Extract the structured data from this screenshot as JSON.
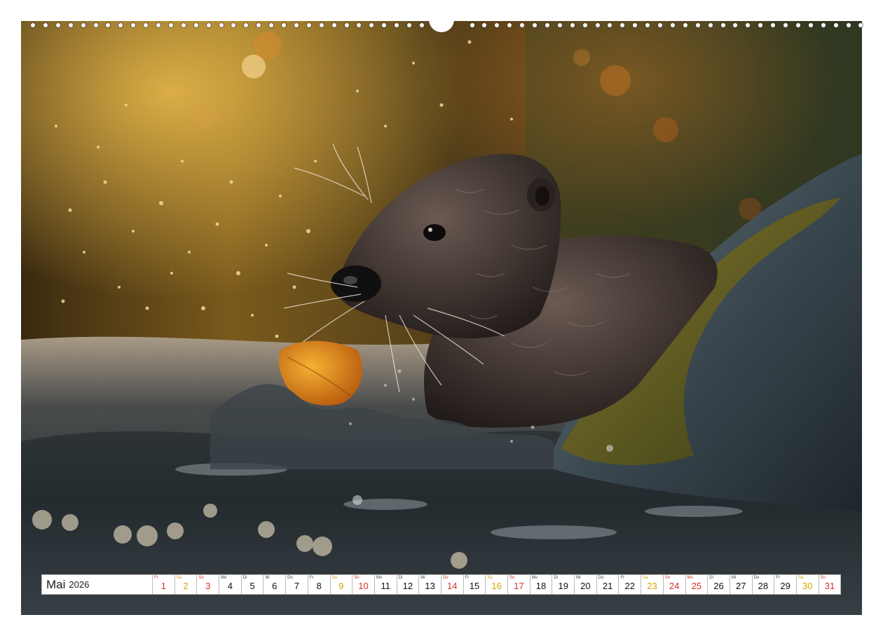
{
  "calendar": {
    "month": "Mai",
    "year": "2026",
    "days": [
      {
        "wd": "Fr",
        "num": "1",
        "type": "hol"
      },
      {
        "wd": "Sa",
        "num": "2",
        "type": "sat"
      },
      {
        "wd": "So",
        "num": "3",
        "type": "sun"
      },
      {
        "wd": "Mo",
        "num": "4",
        "type": "wk"
      },
      {
        "wd": "Di",
        "num": "5",
        "type": "wk"
      },
      {
        "wd": "Mi",
        "num": "6",
        "type": "wk"
      },
      {
        "wd": "Do",
        "num": "7",
        "type": "wk"
      },
      {
        "wd": "Fr",
        "num": "8",
        "type": "wk"
      },
      {
        "wd": "Sa",
        "num": "9",
        "type": "sat"
      },
      {
        "wd": "So",
        "num": "10",
        "type": "sun"
      },
      {
        "wd": "Mo",
        "num": "11",
        "type": "wk"
      },
      {
        "wd": "Di",
        "num": "12",
        "type": "wk"
      },
      {
        "wd": "Mi",
        "num": "13",
        "type": "wk"
      },
      {
        "wd": "Do",
        "num": "14",
        "type": "hol"
      },
      {
        "wd": "Fr",
        "num": "15",
        "type": "wk"
      },
      {
        "wd": "Sa",
        "num": "16",
        "type": "sat"
      },
      {
        "wd": "So",
        "num": "17",
        "type": "sun"
      },
      {
        "wd": "Mo",
        "num": "18",
        "type": "wk"
      },
      {
        "wd": "Di",
        "num": "19",
        "type": "wk"
      },
      {
        "wd": "Mi",
        "num": "20",
        "type": "wk"
      },
      {
        "wd": "Do",
        "num": "21",
        "type": "wk"
      },
      {
        "wd": "Fr",
        "num": "22",
        "type": "wk"
      },
      {
        "wd": "Sa",
        "num": "23",
        "type": "sat"
      },
      {
        "wd": "So",
        "num": "24",
        "type": "sun"
      },
      {
        "wd": "Mo",
        "num": "25",
        "type": "hol"
      },
      {
        "wd": "Di",
        "num": "26",
        "type": "wk"
      },
      {
        "wd": "Mi",
        "num": "27",
        "type": "wk"
      },
      {
        "wd": "Do",
        "num": "28",
        "type": "wk"
      },
      {
        "wd": "Fr",
        "num": "29",
        "type": "wk"
      },
      {
        "wd": "Sa",
        "num": "30",
        "type": "sat"
      },
      {
        "wd": "So",
        "num": "31",
        "type": "sun"
      }
    ]
  },
  "colors": {
    "saturday": "#d9a400",
    "sunday_holiday": "#d4302a",
    "weekday": "#111111"
  },
  "photo": {
    "subject": "otter-photo"
  }
}
